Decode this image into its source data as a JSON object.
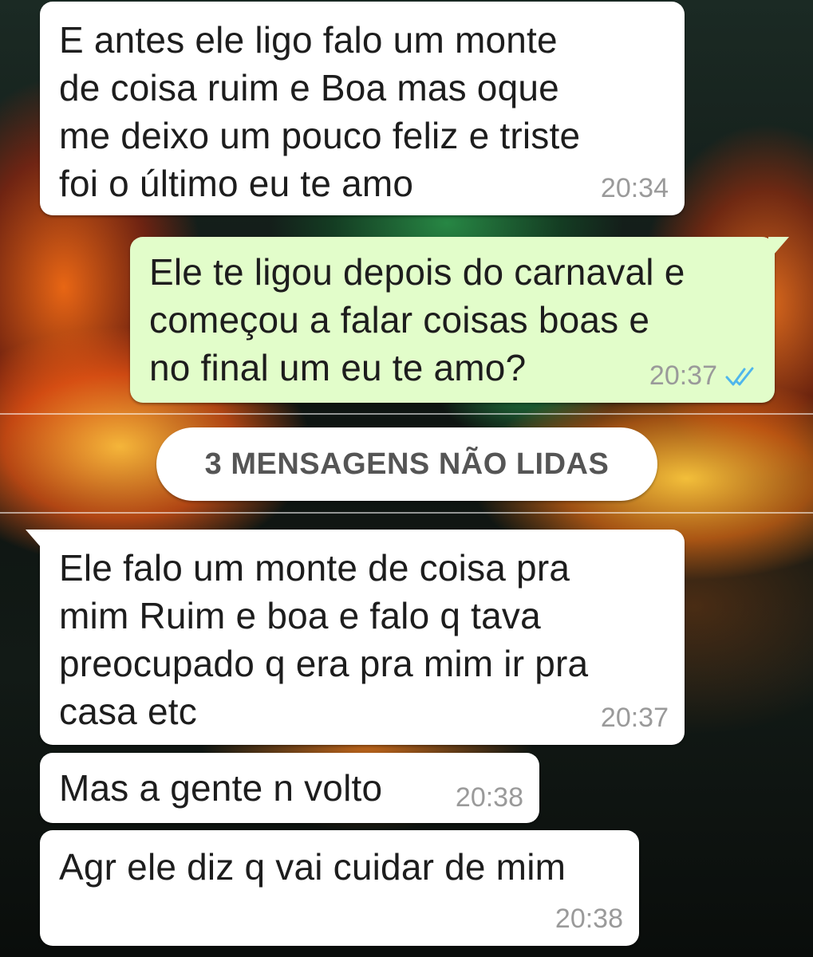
{
  "chat": {
    "messages": [
      {
        "direction": "incoming",
        "text": "E antes ele ligo falo um monte\nde coisa ruim e Boa mas oque\nme deixo um pouco feliz e triste\nfoi o último eu te amo",
        "time": "20:34"
      },
      {
        "direction": "outgoing",
        "text": "Ele te ligou depois do carnaval e\ncomeçou a falar coisas boas e\nno final um eu te amo?",
        "time": "20:37",
        "status_icon": "double-check-read-icon"
      },
      {
        "direction": "incoming",
        "text": "Ele falo um monte de coisa pra\nmim Ruim e boa e falo q tava\npreocupado q era pra mim ir pra\ncasa etc",
        "time": "20:37"
      },
      {
        "direction": "incoming",
        "text": "Mas a gente n volto",
        "time": "20:38"
      },
      {
        "direction": "incoming",
        "text": "Agr ele diz q vai cuidar de mim",
        "time": "20:38"
      }
    ],
    "unread_divider": "3 MENSAGENS NÃO LIDAS"
  },
  "colors": {
    "incoming_bubble": "#ffffff",
    "outgoing_bubble": "#e2fdca",
    "read_check": "#4fb6ec",
    "timestamp": "#9a9a9a"
  }
}
